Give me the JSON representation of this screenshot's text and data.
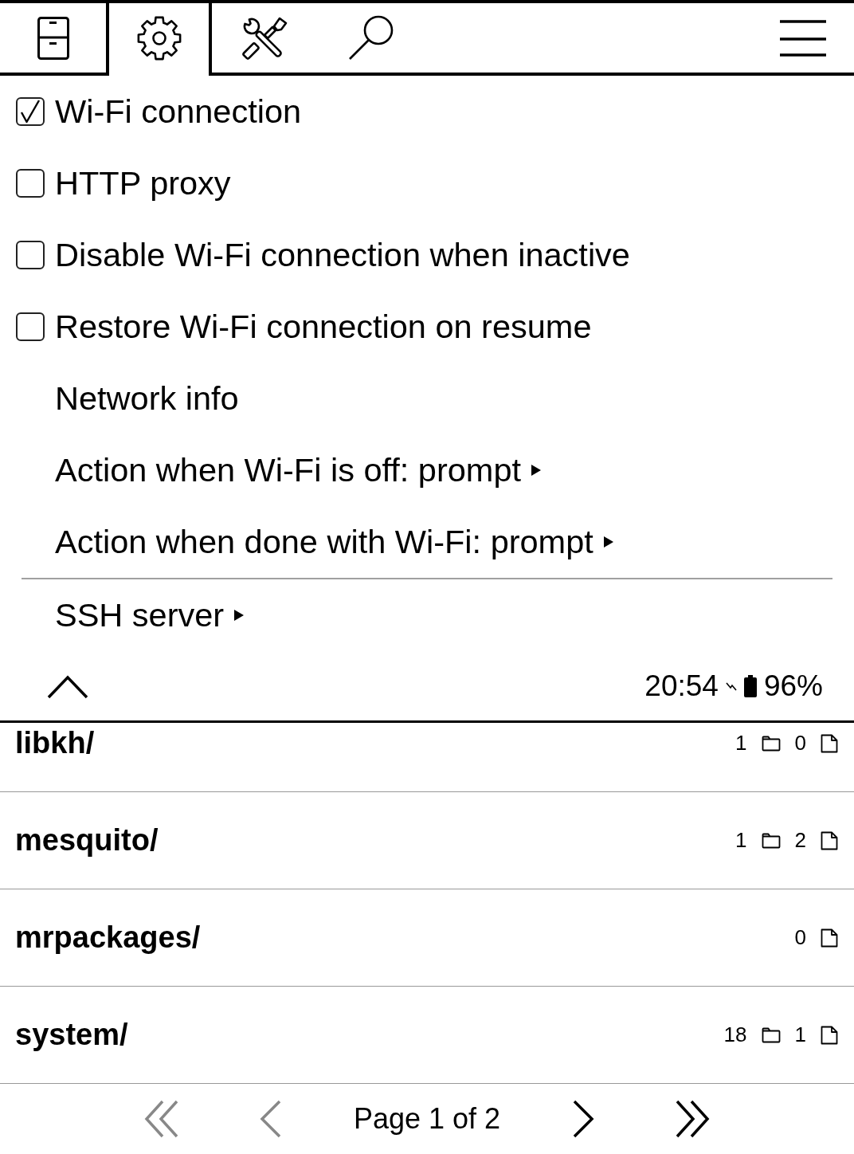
{
  "toolbar": {
    "tabs": [
      {
        "kind": "files",
        "selected": false
      },
      {
        "kind": "settings",
        "selected": true
      },
      {
        "kind": "tools",
        "selected": false
      },
      {
        "kind": "search",
        "selected": false
      }
    ]
  },
  "menu": {
    "items": [
      {
        "kind": "checkbox",
        "label": "Wi-Fi connection",
        "checked": true
      },
      {
        "kind": "checkbox",
        "label": "HTTP proxy",
        "checked": false
      },
      {
        "kind": "checkbox",
        "label": "Disable Wi-Fi connection when inactive",
        "checked": false
      },
      {
        "kind": "checkbox",
        "label": "Restore Wi-Fi connection on resume",
        "checked": false
      },
      {
        "kind": "plain",
        "label": "Network info"
      },
      {
        "kind": "submenu",
        "label": "Action when Wi-Fi is off: prompt"
      },
      {
        "kind": "submenu",
        "label": "Action when done with Wi-Fi: prompt"
      },
      {
        "kind": "separator"
      },
      {
        "kind": "submenu",
        "label": "SSH server"
      }
    ]
  },
  "status": {
    "time": "20:54",
    "charging": true,
    "battery": "96%"
  },
  "files": [
    {
      "name": "libkh/",
      "folders": "1",
      "files": "0"
    },
    {
      "name": "mesquito/",
      "folders": "1",
      "files": "2"
    },
    {
      "name": "mrpackages/",
      "files": "0"
    },
    {
      "name": "system/",
      "folders": "18",
      "files": "1"
    }
  ],
  "pagination": {
    "first": {
      "disabled": true
    },
    "previous": {
      "disabled": true
    },
    "label": "Page 1 of 2",
    "next": {
      "disabled": false
    },
    "last": {
      "disabled": false
    }
  }
}
